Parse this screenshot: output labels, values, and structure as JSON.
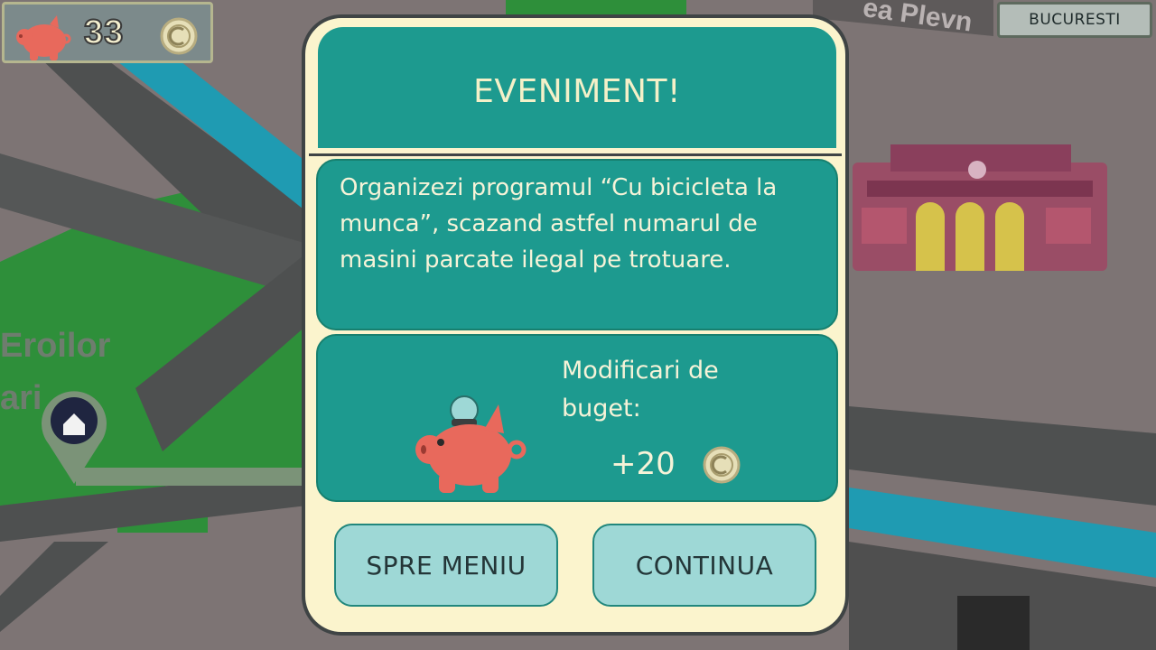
{
  "hud": {
    "coins": "33",
    "city": "BUCURESTI",
    "pig_icon": "piggy-bank-icon",
    "coin_icon": "coin-icon"
  },
  "map": {
    "street_left_line1": "Eroilor",
    "street_left_line2": "ari",
    "street_top": "ea Plevn",
    "location_pin_icon": "home-pin-icon",
    "building_icon": "theatre-building-icon"
  },
  "dialog": {
    "title": "EVENIMENT!",
    "text": "Organizezi programul “Cu bicicleta la munca”, scazand astfel numarul de masini parcate ilegal pe trotuare.",
    "budget_label": "Modificari de buget:",
    "budget_change": "+20",
    "buttons": {
      "menu": "SPRE MENIU",
      "continue": "CONTINUA"
    }
  },
  "colors": {
    "panel_teal": "#1d9a8f",
    "dialog_cream": "#fbf4cd",
    "button_teal": "#9ed8d6",
    "pig_coral": "#e8695c",
    "map_green": "#2f9f3f",
    "map_road": "#4e5050",
    "map_blue": "#20a9c2"
  }
}
